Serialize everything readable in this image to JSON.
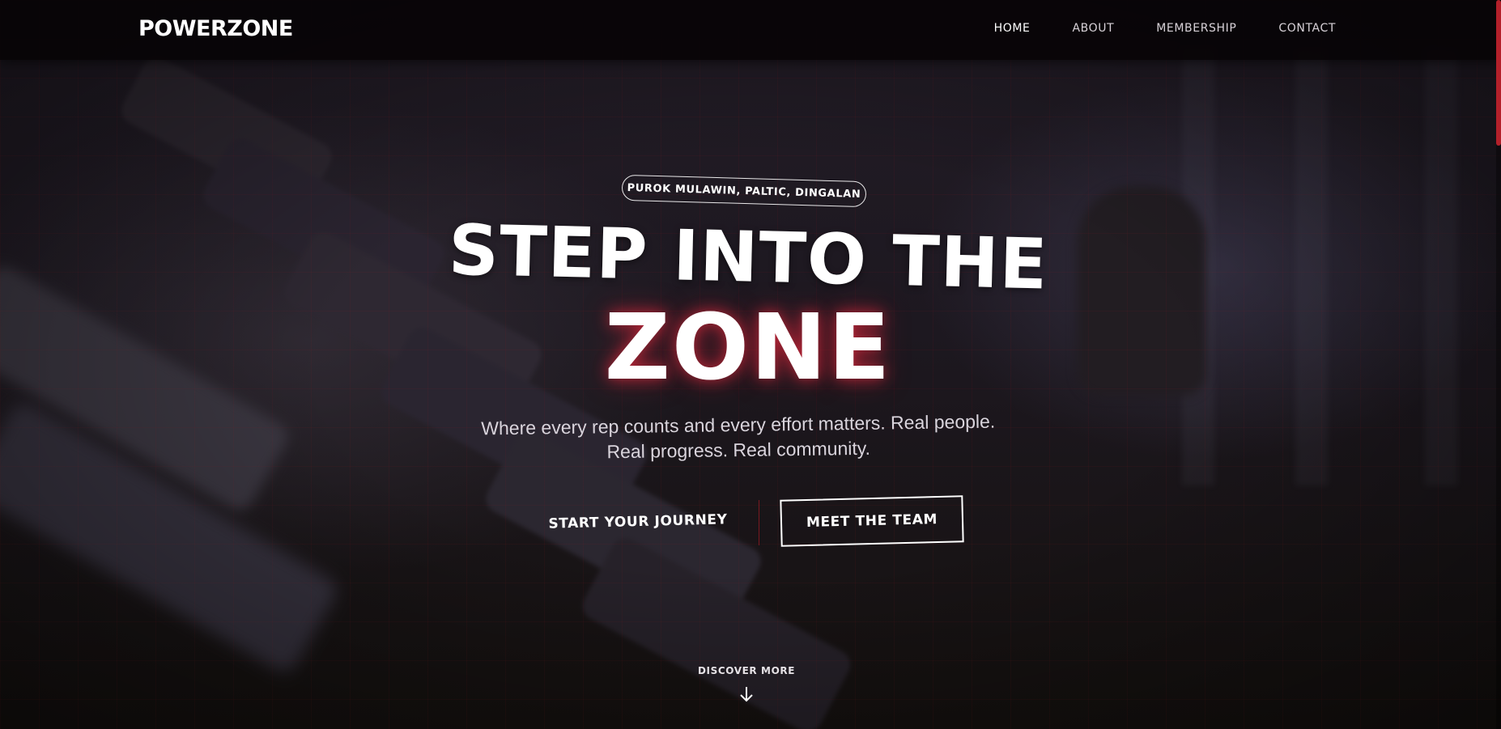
{
  "header": {
    "logo": "POWERZONE",
    "nav": [
      {
        "label": "HOME",
        "active": true
      },
      {
        "label": "ABOUT",
        "active": false
      },
      {
        "label": "MEMBERSHIP",
        "active": false
      },
      {
        "label": "CONTACT",
        "active": false
      }
    ]
  },
  "hero": {
    "location": "PUROK MULAWIN, PALTIC, DINGALAN",
    "headline_line1": "STEP INTO THE",
    "headline_line2": "ZONE",
    "subheading_line1": "Where every rep counts and every effort matters. Real people.",
    "subheading_line2": "Real progress. Real community.",
    "cta_primary": "START YOUR JOURNEY",
    "cta_secondary": "MEET THE TEAM",
    "discover": "DISCOVER MORE",
    "discover_icon": "arrow-down-icon"
  },
  "colors": {
    "accent": "#b3202a",
    "header_bg": "#080406",
    "text": "#ffffff"
  }
}
